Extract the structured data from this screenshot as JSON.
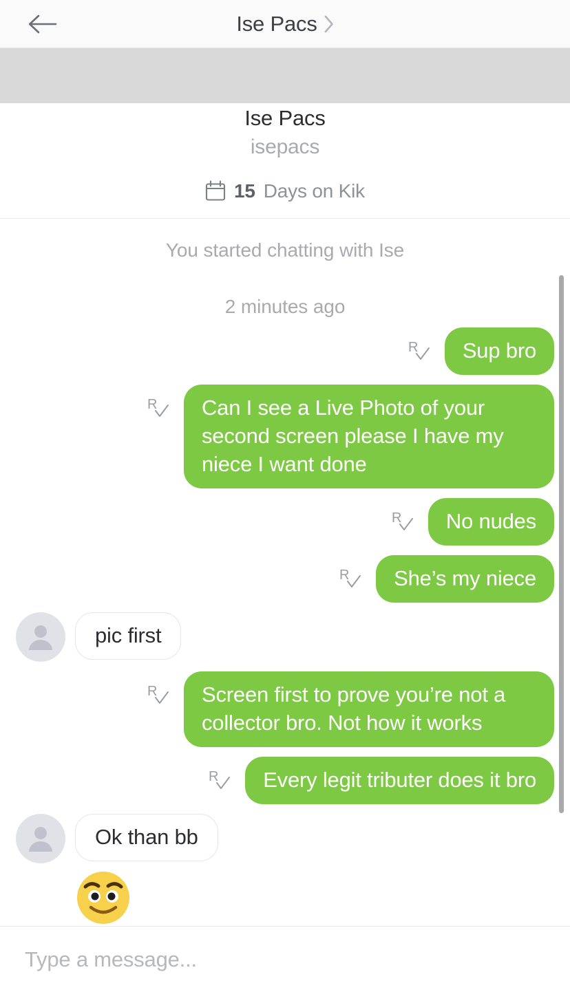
{
  "navbar": {
    "back_icon": "arrow-left-icon",
    "title": "Ise Pacs",
    "chevron_icon": "chevron-right-icon"
  },
  "profile": {
    "name": "Ise Pacs",
    "username": "isepacs",
    "calendar_icon": "calendar-icon",
    "days_count": "15",
    "days_label": "Days on Kik"
  },
  "system": {
    "started": "You started chatting with Ise",
    "timestamp": "2 minutes ago"
  },
  "messages": [
    {
      "id": 0,
      "side": "out",
      "type": "text",
      "text": "Sup bro",
      "receipt": "R"
    },
    {
      "id": 1,
      "side": "out",
      "type": "text",
      "text": "Can I see a Live Photo of your second screen please I have my niece I want done",
      "receipt": "R"
    },
    {
      "id": 2,
      "side": "out",
      "type": "text",
      "text": "No nudes",
      "receipt": "R"
    },
    {
      "id": 3,
      "side": "out",
      "type": "text",
      "text": "She’s my niece",
      "receipt": "R"
    },
    {
      "id": 4,
      "side": "in",
      "type": "text",
      "text": "pic first",
      "avatar_icon": "person-avatar-icon"
    },
    {
      "id": 5,
      "side": "out",
      "type": "text",
      "text": "Screen first to prove you’re not a collector bro. Not how it works",
      "receipt": "R"
    },
    {
      "id": 6,
      "side": "out",
      "type": "text",
      "text": "Every legit tributer does it bro",
      "receipt": "R"
    },
    {
      "id": 7,
      "side": "in",
      "type": "text",
      "text": "Ok than bb",
      "avatar_icon": "person-avatar-icon"
    },
    {
      "id": 8,
      "side": "in",
      "type": "emoji",
      "text": "😊",
      "emoji_name": "smiling-face-emoji"
    }
  ],
  "composer": {
    "placeholder": "Type a message...",
    "value": ""
  },
  "colors": {
    "outgoing_bubble": "#7dc943",
    "incoming_bubble": "#ffffff",
    "incoming_border": "#e4e6e8",
    "navbar_bg": "#fafafa",
    "gray_band": "#d9d9d9",
    "muted_text": "#a9aaae",
    "scrollbar": "#a8a9ad"
  }
}
